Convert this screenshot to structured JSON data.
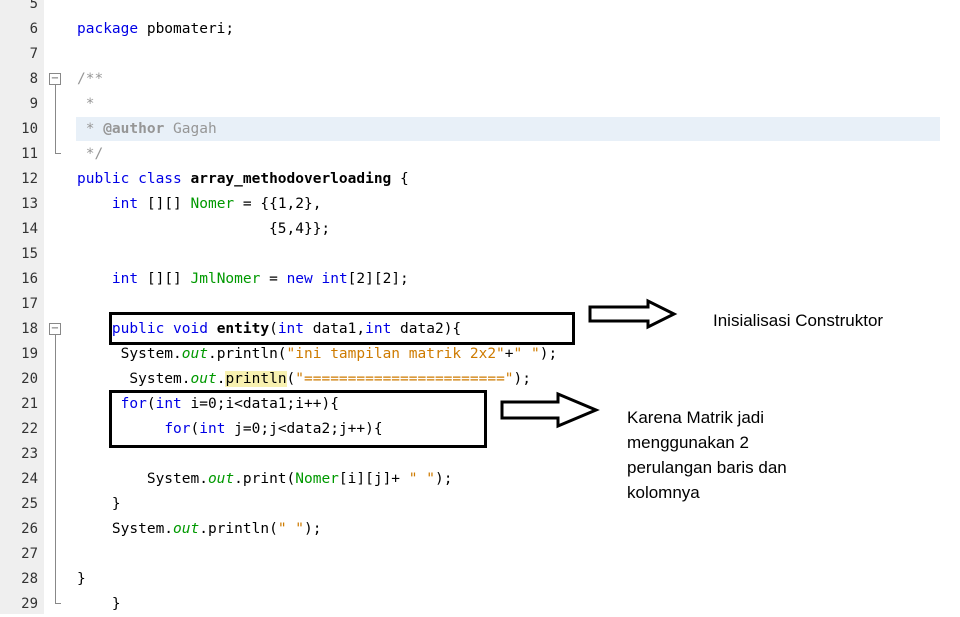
{
  "editor": {
    "lines": [
      {
        "n": "5",
        "t": ""
      },
      {
        "n": "6",
        "t": "package pbomateri;"
      },
      {
        "n": "7",
        "t": ""
      },
      {
        "n": "8",
        "t": "/**"
      },
      {
        "n": "9",
        "t": " *"
      },
      {
        "n": "10",
        "t": " * @author Gagah"
      },
      {
        "n": "11",
        "t": " */"
      },
      {
        "n": "12",
        "t": "public class array_methodoverloading {"
      },
      {
        "n": "13",
        "t": "    int [][] Nomer = {{1,2},"
      },
      {
        "n": "14",
        "t": "                      {5,4}};"
      },
      {
        "n": "15",
        "t": ""
      },
      {
        "n": "16",
        "t": "    int [][] JmlNomer = new int[2][2];"
      },
      {
        "n": "17",
        "t": ""
      },
      {
        "n": "18",
        "t": "    public void entity(int data1,int data2){"
      },
      {
        "n": "19",
        "t": "     System.out.println(\"ini tampilan matrik 2x2\"+\" \");"
      },
      {
        "n": "20",
        "t": "      System.out.println(\"=======================\");"
      },
      {
        "n": "21",
        "t": "     for(int i=0;i<data1;i++){"
      },
      {
        "n": "22",
        "t": "          for(int j=0;j<data2;j++){"
      },
      {
        "n": "23",
        "t": ""
      },
      {
        "n": "24",
        "t": "        System.out.print(Nomer[i][j]+ \" \");"
      },
      {
        "n": "25",
        "t": "    }"
      },
      {
        "n": "26",
        "t": "    System.out.println(\" \");"
      },
      {
        "n": "27",
        "t": ""
      },
      {
        "n": "28",
        "t": "}"
      },
      {
        "n": "29",
        "t": "    }"
      }
    ]
  },
  "annotations": {
    "constructor_note": "Inisialisasi Construktor",
    "loop_note": [
      "Karena Matrik jadi",
      "menggunakan 2",
      "perulangan baris dan",
      "kolomnya"
    ]
  },
  "colors": {
    "keyword": "#0000e6",
    "field": "#009900",
    "string": "#ce7b00",
    "comment": "#969696"
  }
}
